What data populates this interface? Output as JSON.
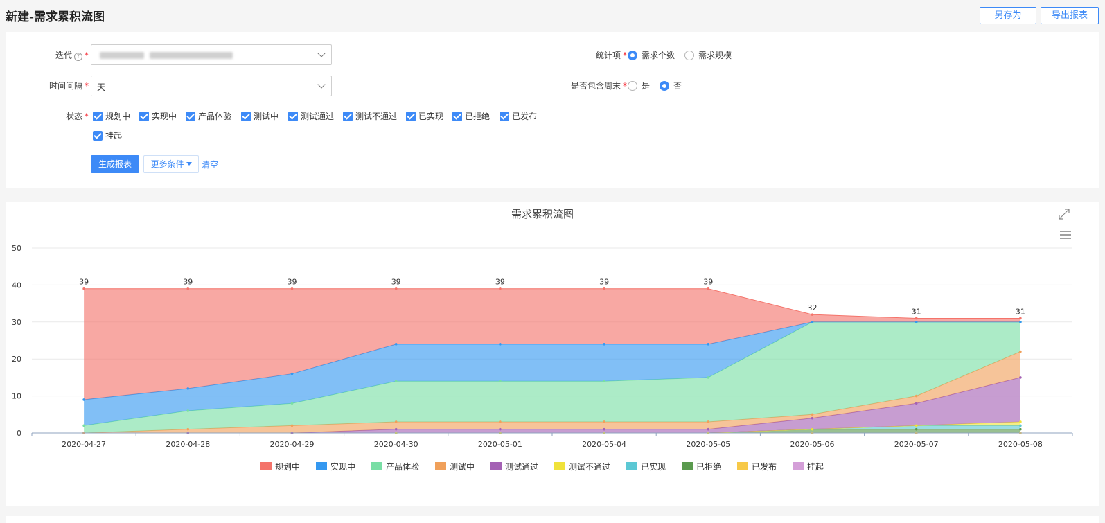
{
  "header": {
    "title": "新建-需求累积流图",
    "save_as_label": "另存为",
    "export_label": "导出报表"
  },
  "form": {
    "iteration_label": "迭代",
    "interval_label": "时间间隔",
    "interval_value": "天",
    "stat_label": "统计项",
    "stat_options": [
      {
        "label": "需求个数",
        "selected": true
      },
      {
        "label": "需求规模",
        "selected": false
      }
    ],
    "weekend_label": "是否包含周末",
    "weekend_options": [
      {
        "label": "是",
        "selected": false
      },
      {
        "label": "否",
        "selected": true
      }
    ],
    "status_label": "状态",
    "statuses": [
      "规划中",
      "实现中",
      "产品体验",
      "测试中",
      "测试通过",
      "测试不通过",
      "已实现",
      "已拒绝",
      "已发布",
      "挂起"
    ],
    "generate_label": "生成报表",
    "more_label": "更多条件",
    "clear_label": "清空"
  },
  "chart_data": {
    "type": "area",
    "stacked": true,
    "title": "需求累积流图",
    "xlabel": "",
    "ylabel": "",
    "ylim": [
      0,
      50
    ],
    "yticks": [
      0,
      10,
      20,
      30,
      40,
      50
    ],
    "grid": true,
    "legend": "bottom-center",
    "categories": [
      "2020-04-27",
      "2020-04-28",
      "2020-04-29",
      "2020-04-30",
      "2020-05-01",
      "2020-05-04",
      "2020-05-05",
      "2020-05-06",
      "2020-05-07",
      "2020-05-08"
    ],
    "series": [
      {
        "name": "挂起",
        "color": "#d49fd8",
        "values": [
          0,
          0,
          0,
          0,
          0,
          0,
          0,
          0,
          0,
          0
        ]
      },
      {
        "name": "已发布",
        "color": "#f7c948",
        "values": [
          0,
          0,
          0,
          0,
          0,
          0,
          0,
          0,
          0,
          0
        ]
      },
      {
        "name": "已拒绝",
        "color": "#5a9a4e",
        "values": [
          0,
          0,
          0,
          0,
          0,
          0,
          0,
          1,
          1,
          1
        ]
      },
      {
        "name": "已实现",
        "color": "#5cc8d4",
        "values": [
          0,
          0,
          0,
          0,
          0,
          0,
          0,
          0,
          1,
          1
        ]
      },
      {
        "name": "测试不通过",
        "color": "#f0e23a",
        "values": [
          0,
          0,
          0,
          0,
          0,
          0,
          0,
          0,
          0,
          1
        ]
      },
      {
        "name": "测试通过",
        "color": "#a461b4",
        "values": [
          0,
          0,
          0,
          1,
          1,
          1,
          1,
          3,
          6,
          12
        ]
      },
      {
        "name": "测试中",
        "color": "#f0a05a",
        "values": [
          0,
          1,
          2,
          2,
          2,
          2,
          2,
          1,
          2,
          7
        ]
      },
      {
        "name": "产品体验",
        "color": "#79dea5",
        "values": [
          2,
          5,
          6,
          11,
          11,
          11,
          12,
          25,
          20,
          8
        ]
      },
      {
        "name": "实现中",
        "color": "#3498f0",
        "values": [
          7,
          6,
          8,
          10,
          10,
          10,
          9,
          0,
          0,
          0
        ]
      },
      {
        "name": "规划中",
        "color": "#f4736a",
        "values": [
          30,
          27,
          23,
          15,
          15,
          15,
          15,
          2,
          1,
          1
        ]
      }
    ],
    "totals": [
      39,
      39,
      39,
      39,
      39,
      39,
      39,
      32,
      31,
      31
    ],
    "legend_order": [
      "规划中",
      "实现中",
      "产品体验",
      "测试中",
      "测试通过",
      "测试不通过",
      "已实现",
      "已拒绝",
      "已发布",
      "挂起"
    ]
  }
}
